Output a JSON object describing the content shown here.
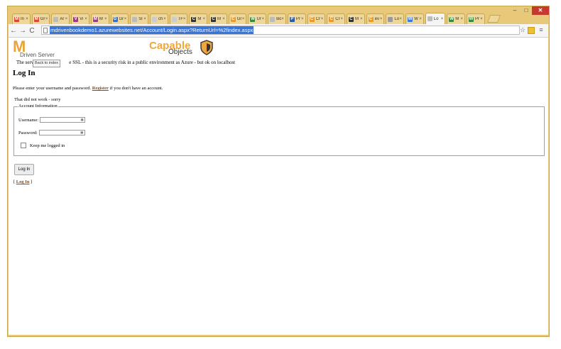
{
  "browser": {
    "tabs": [
      {
        "label": "In",
        "fav": "M",
        "color": "#d64a33"
      },
      {
        "label": "Gr",
        "fav": "M",
        "color": "#d64a33"
      },
      {
        "label": "Ar",
        "fav": "",
        "color": "#bbbbbb"
      },
      {
        "label": "Vi",
        "fav": "V",
        "color": "#9b3a8a"
      },
      {
        "label": "M",
        "fav": "M",
        "color": "#9b3a8a"
      },
      {
        "label": "Gr",
        "fav": "G",
        "color": "#3b6fc2"
      },
      {
        "label": "Sl",
        "fav": "",
        "color": "#bbbbbb"
      },
      {
        "label": "ch",
        "fav": "",
        "color": "#cccccc"
      },
      {
        "label": "TF",
        "fav": "",
        "color": "#cccccc"
      },
      {
        "label": "M",
        "fav": "C",
        "color": "#333333"
      },
      {
        "label": "M",
        "fav": "C",
        "color": "#333333"
      },
      {
        "label": "Gr",
        "fav": "C",
        "color": "#e89a2c"
      },
      {
        "label": "Ur",
        "fav": "W",
        "color": "#3b8a3b"
      },
      {
        "label": "Bo",
        "fav": "",
        "color": "#bbbbbb"
      },
      {
        "label": "Pr",
        "fav": "P",
        "color": "#2b5ba5"
      },
      {
        "label": "Cr",
        "fav": "C",
        "color": "#e89a2c"
      },
      {
        "label": "Cr",
        "fav": "C",
        "color": "#e89a2c"
      },
      {
        "label": "M",
        "fav": "C",
        "color": "#333333"
      },
      {
        "label": "ev",
        "fav": "C",
        "color": "#e89a2c"
      },
      {
        "label": "Lo",
        "fav": "",
        "color": "#999999"
      },
      {
        "label": "W",
        "fav": "W",
        "color": "#3b7ad6"
      },
      {
        "label": "Lo",
        "fav": "",
        "color": "#bbbbbb",
        "active": true
      },
      {
        "label": "M",
        "fav": "W",
        "color": "#3b8a3b"
      },
      {
        "label": "Pr",
        "fav": "W",
        "color": "#3b8a3b"
      }
    ],
    "tab_close": "×",
    "window_controls": {
      "minimize": "–",
      "maximize": "□",
      "close": "✕"
    },
    "nav": {
      "back": "←",
      "forward": "→",
      "reload": "C"
    },
    "address": "mdrivenbookdemo1.azurewebsites.net/Account/Login.aspx?ReturnUrl=%2findex.aspx",
    "star_icon": "☆",
    "menu_icon": "≡"
  },
  "page": {
    "logo_letter": "M",
    "logo_text": "Driven Server",
    "tooltip": "Back to index",
    "brand_capable": "Capable",
    "brand_objects": "Objects",
    "warning_prefix": "The serv",
    "warning_suffix": "e SSL - this is a security risk in a public environment as Azure - but ok on localhost",
    "heading": "Log In",
    "intro_before": "Please enter your username and password.",
    "register_link": "Register",
    "intro_after": "if you don't have an account.",
    "error_message": "That did not work - sorry",
    "legend": "Account Information",
    "username_label": "Username:",
    "password_label": "Password:",
    "field_marker": "✱",
    "remember_label": "Keep me logged in",
    "login_button": "Log In",
    "footer_open": "[",
    "footer_link": "Log In",
    "footer_close": "]"
  }
}
